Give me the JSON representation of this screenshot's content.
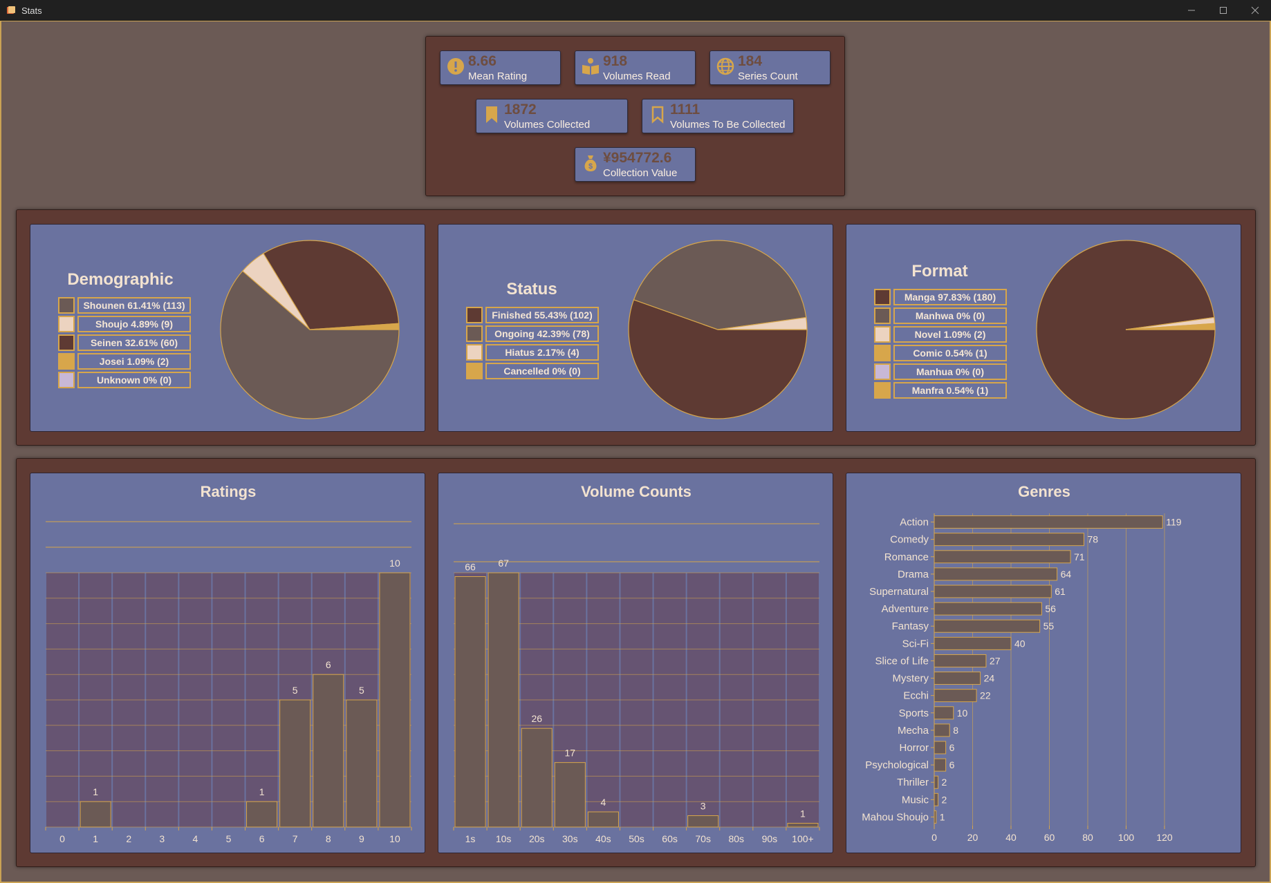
{
  "window": {
    "title": "Stats"
  },
  "colors": {
    "accent": "#d7a64b",
    "card": "#6a729f",
    "panel": "#5e3a33",
    "background": "#6b5a55",
    "bar": "#6b5a55"
  },
  "stats": {
    "mean_rating": {
      "value": "8.66",
      "label": "Mean Rating",
      "icon": "exclamation-circle-icon"
    },
    "volumes_read": {
      "value": "918",
      "label": "Volumes Read",
      "icon": "open-book-icon"
    },
    "series_count": {
      "value": "184",
      "label": "Series Count",
      "icon": "globe-icon"
    },
    "volumes_collected": {
      "value": "1872",
      "label": "Volumes Collected",
      "icon": "bookmark-filled-icon"
    },
    "volumes_to_collect": {
      "value": "1111",
      "label": "Volumes To Be Collected",
      "icon": "bookmark-outline-icon"
    },
    "collection_value": {
      "value": "¥954772.6",
      "label": "Collection Value",
      "icon": "money-bag-icon"
    }
  },
  "demographic": {
    "title": "Demographic",
    "legend": [
      {
        "label": "Shounen 61.41% (113)",
        "color": "#6b5a55"
      },
      {
        "label": "Shoujo 4.89% (9)",
        "color": "#ecd3c0"
      },
      {
        "label": "Seinen 32.61% (60)",
        "color": "#5e3a33"
      },
      {
        "label": "Josei 1.09% (2)",
        "color": "#d7a64b"
      },
      {
        "label": "Unknown 0% (0)",
        "color": "#c8b8d6"
      }
    ]
  },
  "status": {
    "title": "Status",
    "legend": [
      {
        "label": "Finished 55.43% (102)",
        "color": "#5e3a33"
      },
      {
        "label": "Ongoing 42.39% (78)",
        "color": "#6b5a55"
      },
      {
        "label": "Hiatus 2.17% (4)",
        "color": "#ecd3c0"
      },
      {
        "label": "Cancelled 0% (0)",
        "color": "#d7a64b"
      }
    ]
  },
  "format": {
    "title": "Format",
    "legend": [
      {
        "label": "Manga 97.83% (180)",
        "color": "#5e3a33"
      },
      {
        "label": "Manhwa 0% (0)",
        "color": "#6b5a55"
      },
      {
        "label": "Novel 1.09% (2)",
        "color": "#ecd3c0"
      },
      {
        "label": "Comic 0.54% (1)",
        "color": "#d7a64b"
      },
      {
        "label": "Manhua 0% (0)",
        "color": "#c8b8d6"
      },
      {
        "label": "Manfra 0.54% (1)",
        "color": "#d7a64b"
      }
    ]
  },
  "chart_data": [
    {
      "type": "pie",
      "title": "Demographic",
      "labels": [
        "Shounen",
        "Shoujo",
        "Seinen",
        "Josei",
        "Unknown"
      ],
      "values": [
        113,
        9,
        60,
        2,
        0
      ],
      "colors": [
        "#6b5a55",
        "#ecd3c0",
        "#5e3a33",
        "#d7a64b",
        "#c8b8d6"
      ]
    },
    {
      "type": "pie",
      "title": "Status",
      "labels": [
        "Finished",
        "Ongoing",
        "Hiatus",
        "Cancelled"
      ],
      "values": [
        102,
        78,
        4,
        0
      ],
      "colors": [
        "#5e3a33",
        "#6b5a55",
        "#ecd3c0",
        "#d7a64b"
      ]
    },
    {
      "type": "pie",
      "title": "Format",
      "labels": [
        "Manga",
        "Manhwa",
        "Novel",
        "Comic",
        "Manhua",
        "Manfra"
      ],
      "values": [
        180,
        0,
        2,
        1,
        0,
        1
      ],
      "colors": [
        "#5e3a33",
        "#6b5a55",
        "#ecd3c0",
        "#d7a64b",
        "#c8b8d6",
        "#d7a64b"
      ]
    },
    {
      "type": "bar",
      "title": "Ratings",
      "categories": [
        "0",
        "1",
        "2",
        "3",
        "4",
        "5",
        "6",
        "7",
        "8",
        "9",
        "10"
      ],
      "values": [
        0,
        1,
        0,
        0,
        0,
        0,
        1,
        5,
        6,
        5,
        10
      ],
      "ylim": [
        0,
        10
      ]
    },
    {
      "type": "bar",
      "title": "Volume Counts",
      "categories": [
        "1s",
        "10s",
        "20s",
        "30s",
        "40s",
        "50s",
        "60s",
        "70s",
        "80s",
        "90s",
        "100+"
      ],
      "values": [
        66,
        67,
        26,
        17,
        4,
        0,
        0,
        3,
        0,
        0,
        1
      ],
      "ylim": [
        0,
        67
      ]
    },
    {
      "type": "bar",
      "orientation": "horizontal",
      "title": "Genres",
      "categories": [
        "Action",
        "Comedy",
        "Romance",
        "Drama",
        "Supernatural",
        "Adventure",
        "Fantasy",
        "Sci-Fi",
        "Slice of Life",
        "Mystery",
        "Ecchi",
        "Sports",
        "Mecha",
        "Horror",
        "Psychological",
        "Thriller",
        "Music",
        "Mahou Shoujo"
      ],
      "values": [
        119,
        78,
        71,
        64,
        61,
        56,
        55,
        40,
        27,
        24,
        22,
        10,
        8,
        6,
        6,
        2,
        2,
        1
      ],
      "xticks": [
        "0",
        "20",
        "40",
        "60",
        "80",
        "100",
        "120"
      ],
      "xlim": [
        0,
        120
      ]
    }
  ]
}
